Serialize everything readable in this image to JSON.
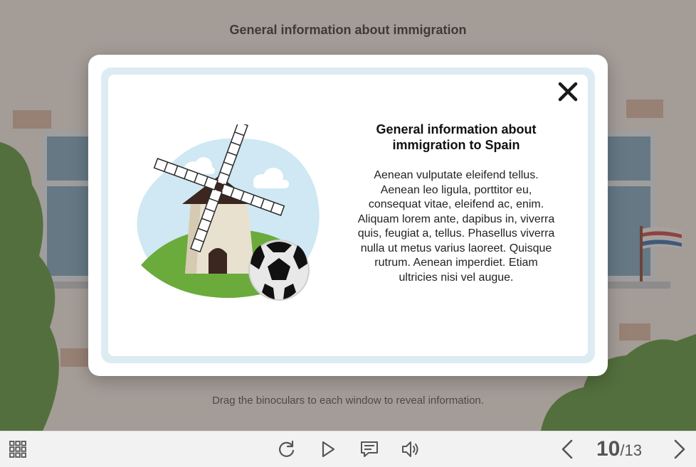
{
  "slide": {
    "title": "General information about immigration",
    "instruction": "Drag the binoculars to each window to reveal information."
  },
  "modal": {
    "heading": "General information about immigration to Spain",
    "body": "Aenean vulputate eleifend tellus. Aenean leo ligula, porttitor eu, consequat vitae, eleifend ac, enim. Aliquam lorem ante, dapibus in, viverra quis, feugiat a, tellus. Phasellus viverra nulla ut metus varius laoreet. Quisque rutrum. Aenean imperdiet. Etiam ultricies nisi vel augue.",
    "close_icon": "close-x-icon",
    "illustration": "windmill-and-soccer-ball"
  },
  "toolbar": {
    "menu_icon": "grid-menu-icon",
    "replay_icon": "replay-icon",
    "play_icon": "play-icon",
    "comment_icon": "comment-icon",
    "volume_icon": "volume-icon",
    "prev_icon": "chevron-left-icon",
    "next_icon": "chevron-right-icon",
    "page_current": "10",
    "page_separator": "/",
    "page_total": "13"
  },
  "colors": {
    "modal_frame": "#ddebf2",
    "sky": "#cfe8f3",
    "grass": "#6aab3c",
    "dim_overlay": "rgba(70,60,55,0.45)",
    "toolbar_bg": "#f2f2f2"
  }
}
